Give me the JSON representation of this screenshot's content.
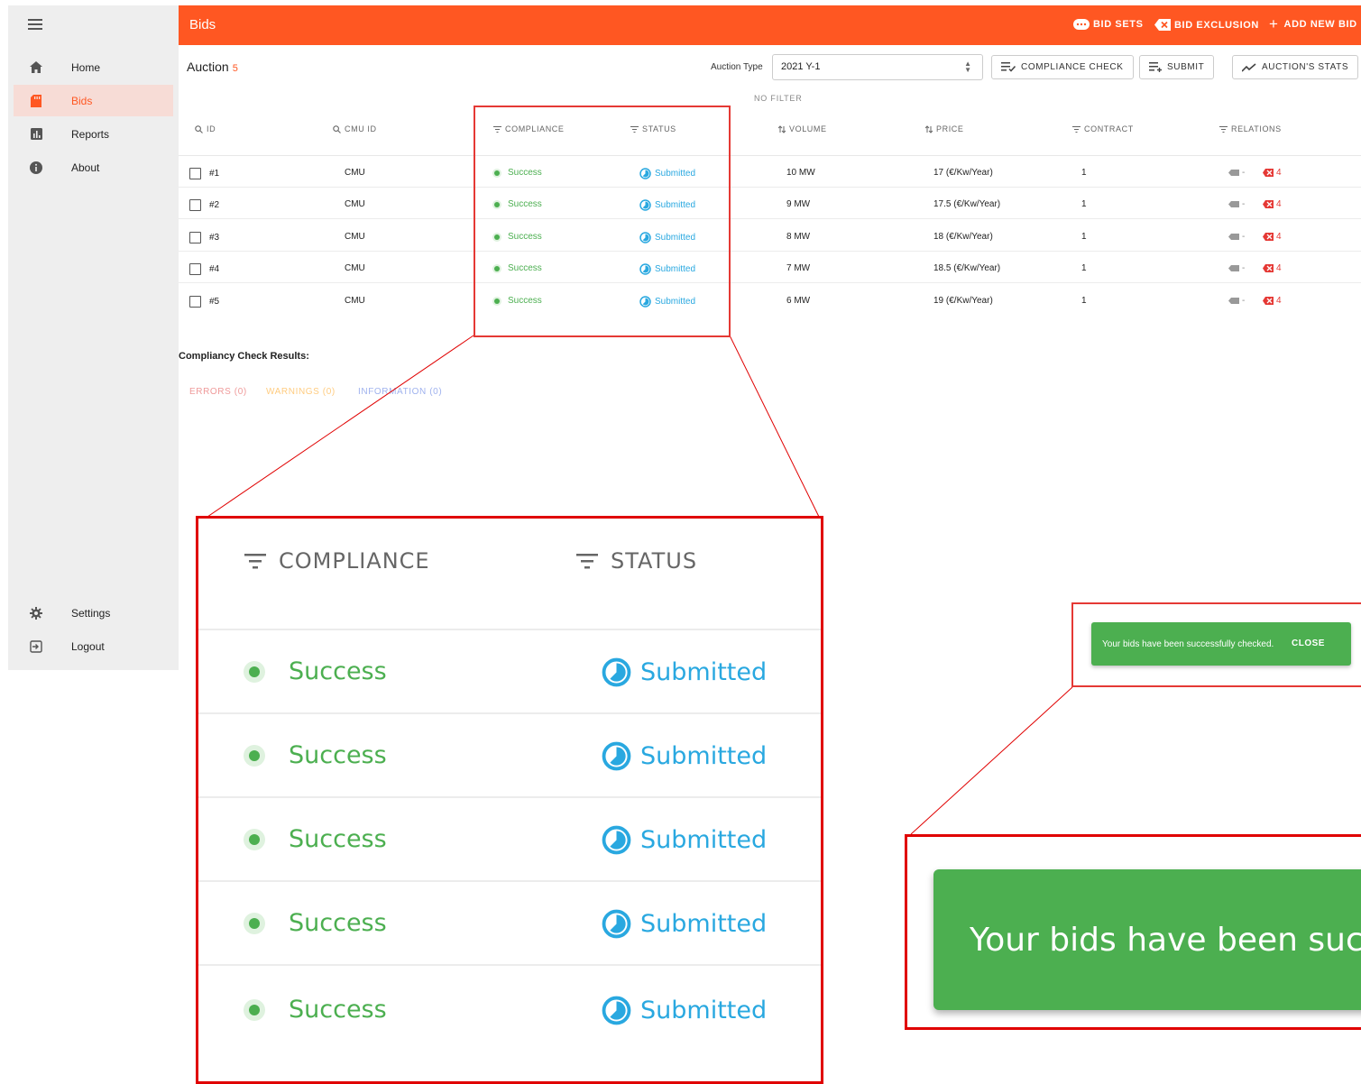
{
  "sidebar": {
    "items": [
      {
        "label": "Home",
        "icon": "home-icon"
      },
      {
        "label": "Bids",
        "icon": "bids-icon",
        "active": true
      },
      {
        "label": "Reports",
        "icon": "reports-icon"
      },
      {
        "label": "About",
        "icon": "info-icon"
      }
    ],
    "bottom": [
      {
        "label": "Settings",
        "icon": "gear-icon"
      },
      {
        "label": "Logout",
        "icon": "logout-icon"
      }
    ]
  },
  "topbar": {
    "title": "Bids",
    "bid_sets": "BID SETS",
    "bid_exclusion": "BID EXCLUSION",
    "add_new_bid": "ADD NEW BID"
  },
  "toolbar": {
    "auction_label": "Auction",
    "auction_count": "5",
    "auction_type_label": "Auction Type",
    "auction_type_value": "2021 Y-1",
    "compliance_check": "COMPLIANCE CHECK",
    "submit": "SUBMIT",
    "auction_stats": "AUCTION'S STATS",
    "no_filter": "NO FILTER"
  },
  "table": {
    "headers": {
      "id": "ID",
      "cmu_id": "CMU ID",
      "compliance": "COMPLIANCE",
      "status": "STATUS",
      "volume": "VOLUME",
      "price": "PRICE",
      "contract": "CONTRACT",
      "relations": "RELATIONS"
    },
    "rows": [
      {
        "id": "#1",
        "cmu": "CMU",
        "compliance": "Success",
        "status": "Submitted",
        "volume": "10 MW",
        "price": "17 (€/Kw/Year)",
        "contract": "1",
        "rel_a": "-",
        "rel_b": "4"
      },
      {
        "id": "#2",
        "cmu": "CMU",
        "compliance": "Success",
        "status": "Submitted",
        "volume": "9 MW",
        "price": "17.5 (€/Kw/Year)",
        "contract": "1",
        "rel_a": "-",
        "rel_b": "4"
      },
      {
        "id": "#3",
        "cmu": "CMU",
        "compliance": "Success",
        "status": "Submitted",
        "volume": "8 MW",
        "price": "18 (€/Kw/Year)",
        "contract": "1",
        "rel_a": "-",
        "rel_b": "4"
      },
      {
        "id": "#4",
        "cmu": "CMU",
        "compliance": "Success",
        "status": "Submitted",
        "volume": "7 MW",
        "price": "18.5 (€/Kw/Year)",
        "contract": "1",
        "rel_a": "-",
        "rel_b": "4"
      },
      {
        "id": "#5",
        "cmu": "CMU",
        "compliance": "Success",
        "status": "Submitted",
        "volume": "6 MW",
        "price": "19 (€/Kw/Year)",
        "contract": "1",
        "rel_a": "-",
        "rel_b": "4"
      }
    ]
  },
  "results": {
    "title": "Compliancy Check Results:",
    "errors": "ERRORS (0)",
    "warnings": "WARNINGS (0)",
    "information": "INFORMATION (0)"
  },
  "snackbar": {
    "message": "Your bids have been successfully checked.",
    "close": "CLOSE",
    "zoom_text": "Your bids have been success"
  },
  "colors": {
    "brand": "#ff5722",
    "success": "#4caf50",
    "submitted": "#29a8e0",
    "error": "#e53935",
    "warning": "#ffb74d",
    "info": "#90a4e8",
    "annotation": "#e00000"
  }
}
